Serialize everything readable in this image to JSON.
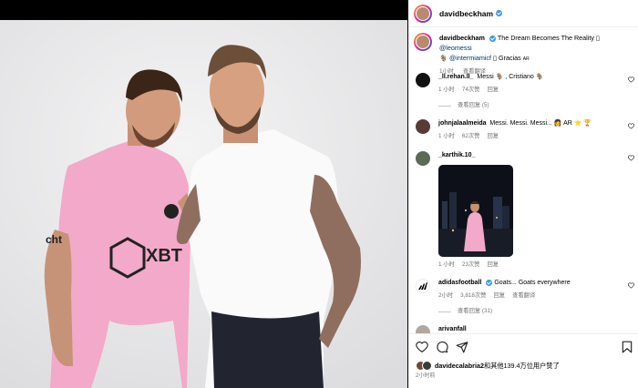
{
  "post": {
    "author": "davidbeckham",
    "caption": {
      "username": "davidbeckham",
      "text_main": "The Dream Becomes The Reality",
      "mention1": "@leomessi",
      "mention2": "@intermiamicf",
      "text_tail": "Gracias",
      "time": "1小时",
      "translate": "查看翻译"
    },
    "comments": [
      {
        "username": "_ll.rehan.ll_",
        "text": "Messi 🐐 , Cristiano 🐐",
        "time": "1 小时",
        "likes": "74次赞",
        "reply": "回复",
        "view_replies": "查看回复 (5)",
        "avatar_color": "#111111"
      },
      {
        "username": "johnjalaalmeida",
        "text": "Messi. Messi. Messi... 👩 AR ⭐ 🏆",
        "time": "1 小时",
        "likes": "62次赞",
        "reply": "回复",
        "avatar_color": "#5a3a34"
      },
      {
        "username": "_karthik.10_",
        "text": "",
        "time": "1 小时",
        "likes": "23次赞",
        "reply": "回复",
        "avatar_color": "#5b6a54"
      },
      {
        "username": "adidasfootball",
        "text": "Goats... Goats everywhere",
        "time": "2小时",
        "likes": "3,818次赞",
        "reply": "回复",
        "translate": "查看翻译",
        "view_replies": "查看回复 (31)",
        "avatar_color": "#ffffff"
      },
      {
        "username": "arivanfall",
        "avatar_color": "#b0a8a0"
      }
    ],
    "likes_text_user": "davidecalabria2",
    "likes_text_rest": "和其他139.4万位用户赞了",
    "timeago": "2小时前"
  }
}
